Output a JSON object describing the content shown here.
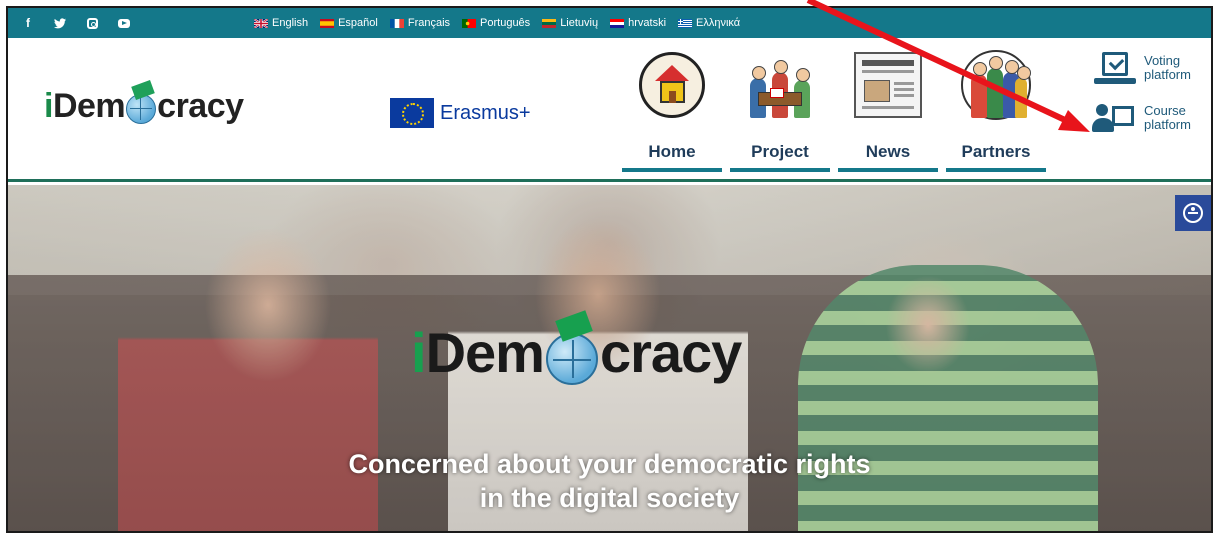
{
  "topbar": {
    "social": [
      "facebook-icon",
      "twitter-icon",
      "instagram-icon",
      "youtube-icon"
    ],
    "languages": [
      {
        "label": "English",
        "flag": "uk"
      },
      {
        "label": "Español",
        "flag": "es"
      },
      {
        "label": "Français",
        "flag": "fr"
      },
      {
        "label": "Português",
        "flag": "pt"
      },
      {
        "label": "Lietuvių",
        "flag": "lt"
      },
      {
        "label": "hrvatski",
        "flag": "hr"
      },
      {
        "label": "Ελληνικά",
        "flag": "gr"
      }
    ],
    "bg_color": "#14788a"
  },
  "header": {
    "logo": {
      "prefix": "i",
      "part1": "Dem",
      "part2": "cracy"
    },
    "erasmus_label": "Erasmus+",
    "nav": [
      {
        "label": "Home",
        "icon": "house-icon"
      },
      {
        "label": "Project",
        "icon": "meeting-icon"
      },
      {
        "label": "News",
        "icon": "newspaper-icon"
      },
      {
        "label": "Partners",
        "icon": "group-icon"
      }
    ],
    "side_links": [
      {
        "line1": "Voting",
        "line2": "platform",
        "icon": "voting-icon"
      },
      {
        "line1": "Course",
        "line2": "platform",
        "icon": "course-icon"
      }
    ]
  },
  "hero": {
    "logo": {
      "prefix": "i",
      "part1": "Dem",
      "part2": "cracy"
    },
    "tagline_line1": "Concerned about your democratic rights",
    "tagline_line2": "in the digital society"
  },
  "annotation": {
    "arrow_color": "#e8141b"
  }
}
